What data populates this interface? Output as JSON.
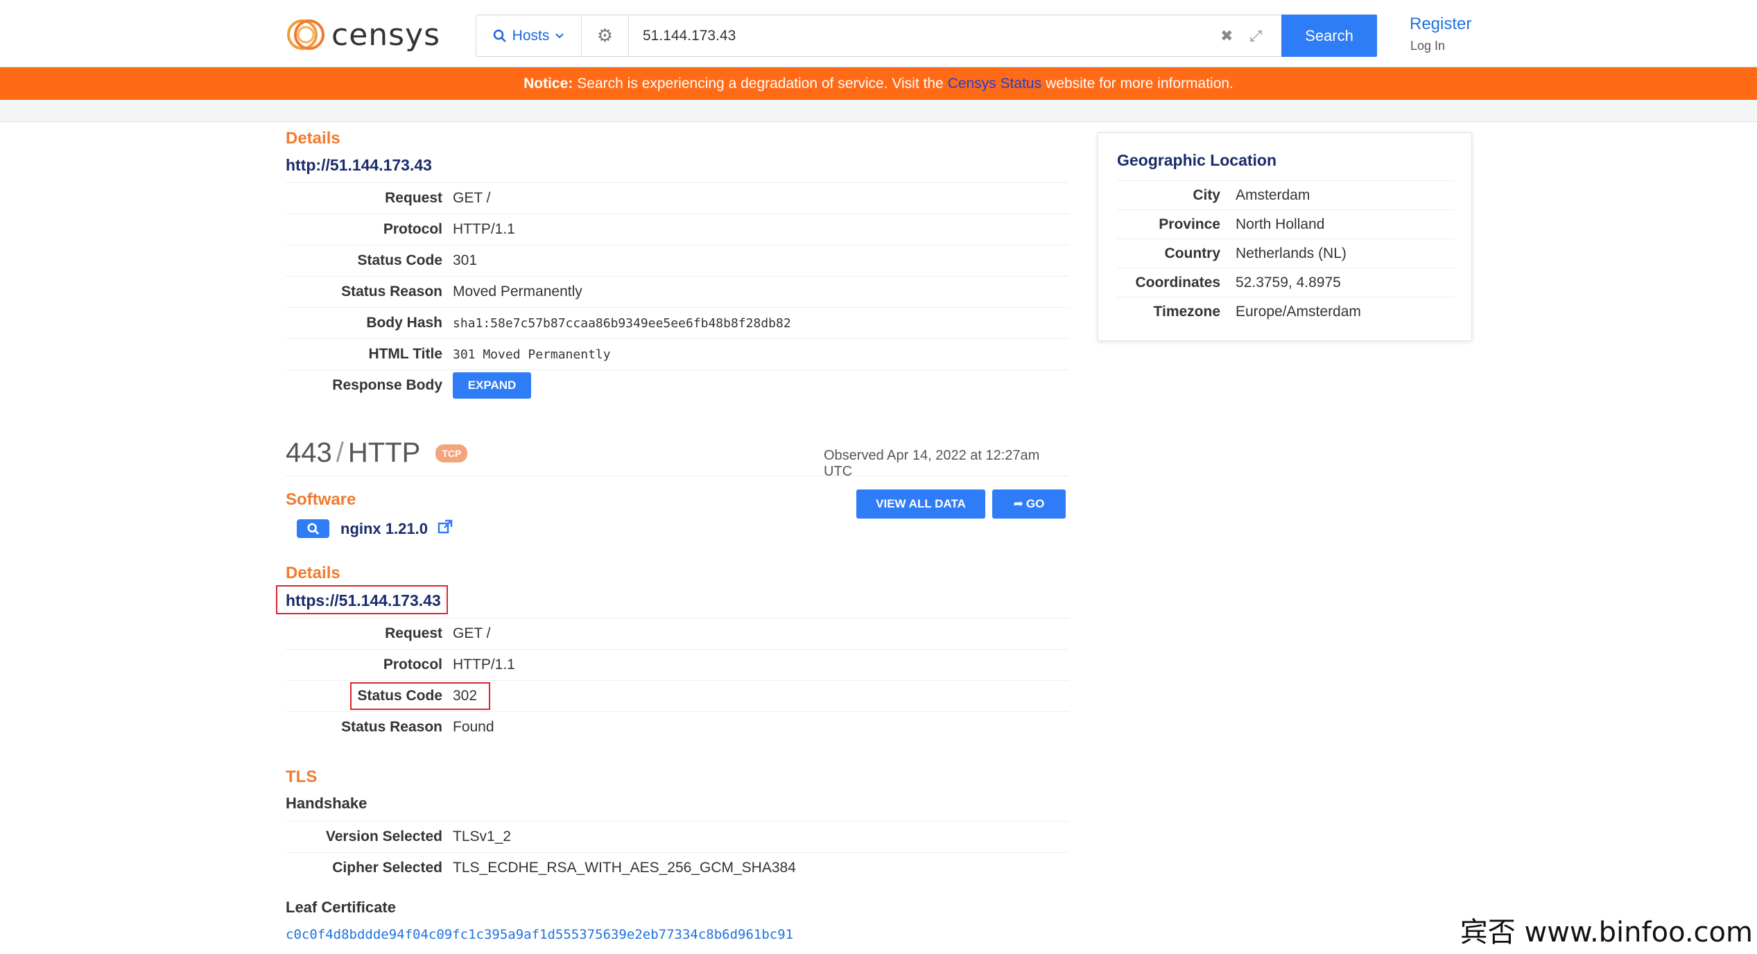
{
  "header": {
    "logo_text": "censys",
    "search_type": "Hosts",
    "search_value": "51.144.173.43",
    "search_button": "Search",
    "register": "Register",
    "login": "Log In"
  },
  "notice": {
    "label": "Notice:",
    "text_before": "Search is experiencing a degradation of service. Visit the",
    "link": "Censys Status",
    "text_after": "website for more information."
  },
  "http80": {
    "details_title": "Details",
    "url": "http://51.144.173.43",
    "rows": [
      {
        "key": "Request",
        "value": "GET /"
      },
      {
        "key": "Protocol",
        "value": "HTTP/1.1"
      },
      {
        "key": "Status Code",
        "value": "301"
      },
      {
        "key": "Status Reason",
        "value": "Moved Permanently"
      },
      {
        "key": "Body Hash",
        "value": "sha1:58e7c57b87ccaa86b9349ee5ee6fb48b8f28db82"
      },
      {
        "key": "HTML Title",
        "value": "301 Moved Permanently"
      }
    ],
    "response_body_key": "Response Body",
    "expand_button": "EXPAND"
  },
  "service443": {
    "port": "443",
    "protocol": "HTTP",
    "transport_badge": "TCP",
    "observed": "Observed Apr 14, 2022 at 12:27am UTC",
    "view_all_button": "VIEW ALL DATA",
    "go_button": "GO",
    "software_title": "Software",
    "software_name": "nginx 1.21.0",
    "details_title": "Details",
    "url": "https://51.144.173.43",
    "rows": [
      {
        "key": "Request",
        "value": "GET /"
      },
      {
        "key": "Protocol",
        "value": "HTTP/1.1"
      },
      {
        "key": "Status Code",
        "value": "302"
      },
      {
        "key": "Status Reason",
        "value": "Found"
      }
    ],
    "tls_title": "TLS",
    "handshake_title": "Handshake",
    "tls_rows": [
      {
        "key": "Version Selected",
        "value": "TLSv1_2"
      },
      {
        "key": "Cipher Selected",
        "value": "TLS_ECDHE_RSA_WITH_AES_256_GCM_SHA384"
      }
    ],
    "leaf_cert_title": "Leaf Certificate",
    "leaf_cert_hash": "c0c0f4d8bddde94f04c09fc1c395a9af1d555375639e2eb77334c8b6d961bc91"
  },
  "geo": {
    "title": "Geographic Location",
    "rows": [
      {
        "key": "City",
        "value": "Amsterdam"
      },
      {
        "key": "Province",
        "value": "North Holland"
      },
      {
        "key": "Country",
        "value": "Netherlands (NL)"
      },
      {
        "key": "Coordinates",
        "value": "52.3759, 4.8975"
      },
      {
        "key": "Timezone",
        "value": "Europe/Amsterdam"
      }
    ]
  },
  "watermark": "宾否 www.binfoo.com",
  "colors": {
    "accent_orange": "#f07b2e",
    "notice_bg": "#ff6a16",
    "primary_blue": "#2e7cf6",
    "highlight_red": "#d9262c"
  }
}
